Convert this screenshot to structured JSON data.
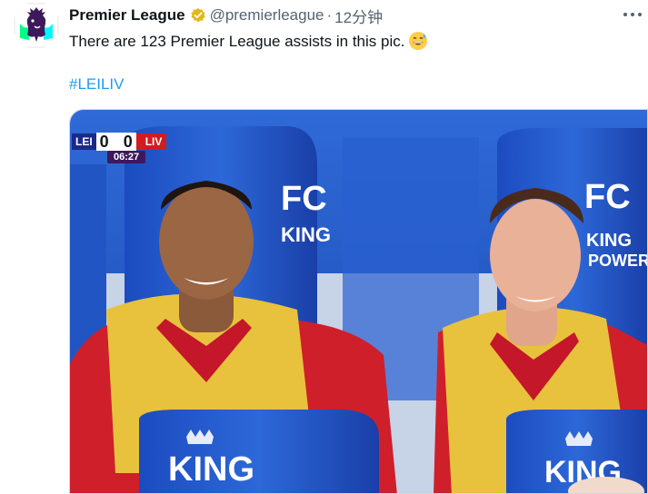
{
  "account": {
    "display_name": "Premier League",
    "handle": "@premierleague",
    "separator": "·",
    "time": "12分钟",
    "verified": true,
    "avatar_icon": "premier-league-lion-icon"
  },
  "more_icon": "more-dots-icon",
  "tweet": {
    "text": "There are 123 Premier League assists in this pic.",
    "emoji": "grinning-face-with-sweat-emoji",
    "hashtag": "#LEILIV"
  },
  "media": {
    "scoreboard": {
      "home": "LEI",
      "home_score": "0",
      "away_score": "0",
      "away": "LIV",
      "clock": "06:27"
    },
    "seat_branding": [
      "KING",
      "POWER"
    ]
  },
  "colors": {
    "link": "#1d9bf0",
    "verified_badge": "#e2b719",
    "pl_purple": "#3d195b",
    "seat_blue": "#1f4fbf"
  }
}
